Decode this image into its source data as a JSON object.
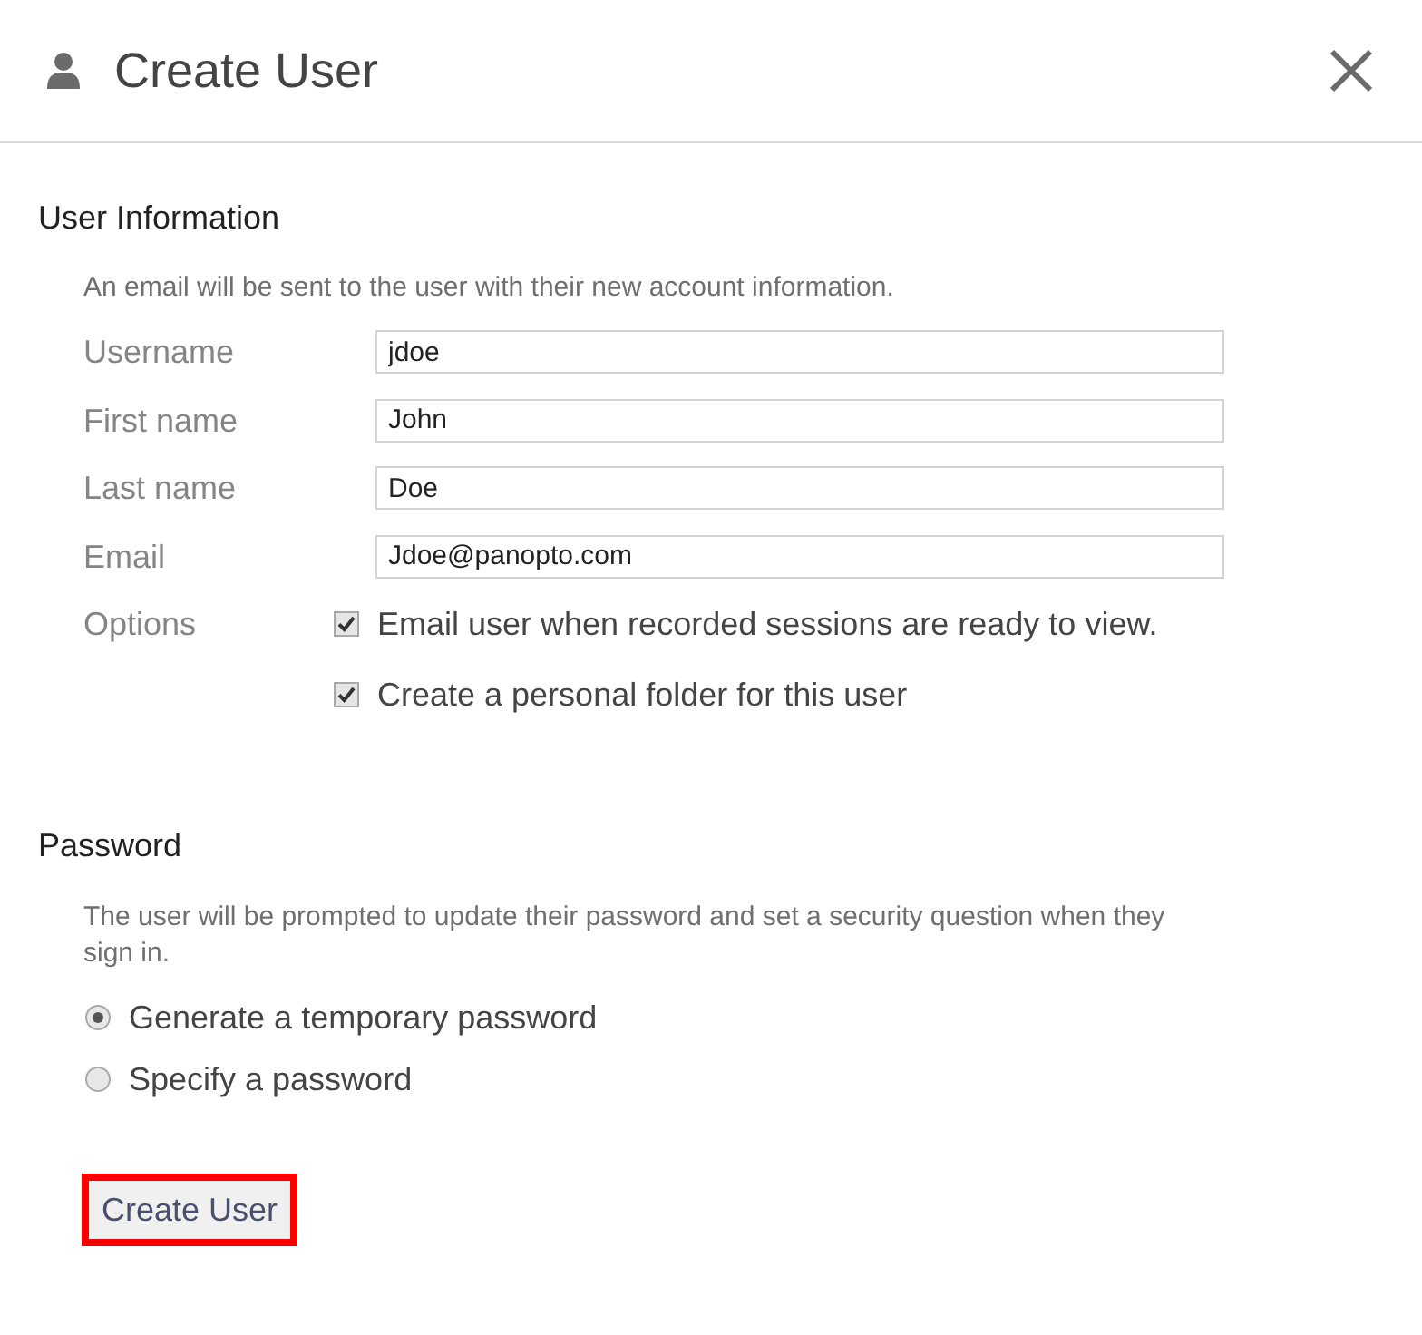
{
  "dialog": {
    "title": "Create User"
  },
  "user_information": {
    "heading": "User Information",
    "description": "An email will be sent to the user with their new account information.",
    "fields": [
      {
        "label": "Username",
        "value": "jdoe"
      },
      {
        "label": "First name",
        "value": "John"
      },
      {
        "label": "Last name",
        "value": "Doe"
      },
      {
        "label": "Email",
        "value": "Jdoe@panopto.com"
      }
    ],
    "options": {
      "label": "Options",
      "checkboxes": [
        {
          "label": "Email user when recorded sessions are ready to view.",
          "checked": true
        },
        {
          "label": "Create a personal folder for this user",
          "checked": true
        }
      ]
    }
  },
  "password": {
    "heading": "Password",
    "description": "The user will be prompted to update their password and set a security question when they sign in.",
    "choices": [
      {
        "label": "Generate a temporary password",
        "selected": true
      },
      {
        "label": "Specify a password",
        "selected": false
      }
    ]
  },
  "submit_button": {
    "label": "Create User",
    "highlighted": true
  }
}
